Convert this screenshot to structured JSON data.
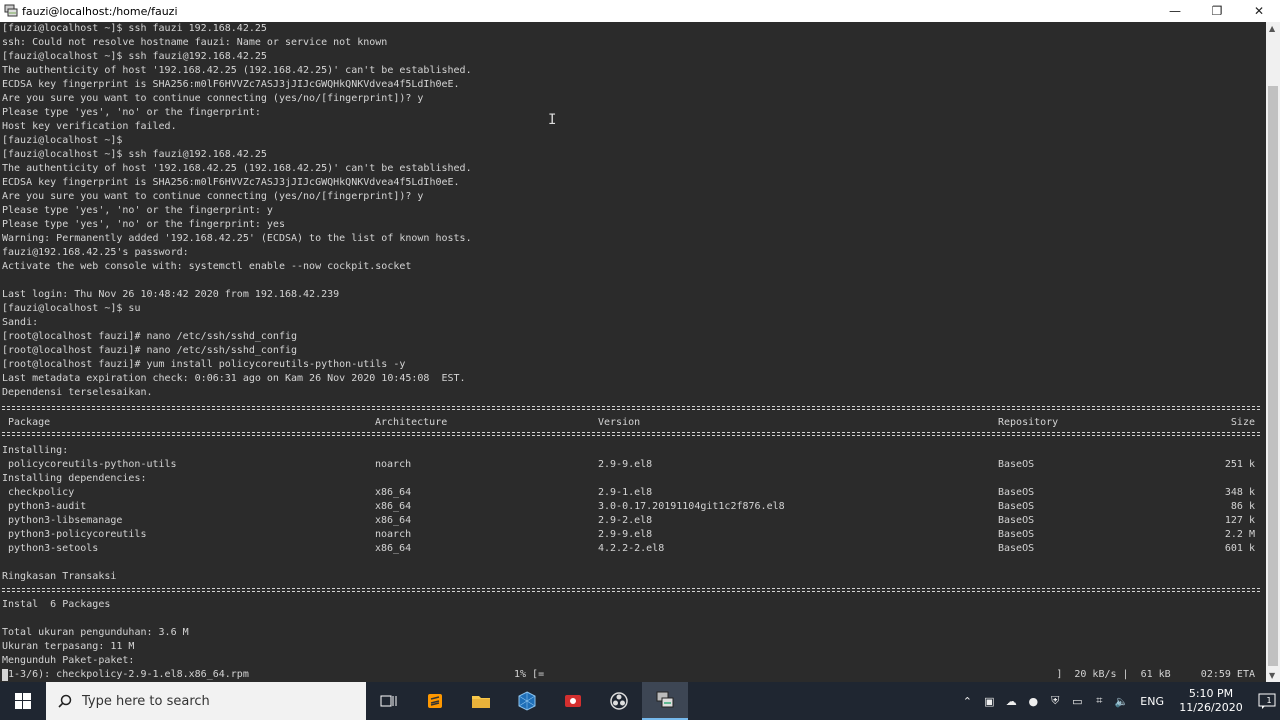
{
  "window": {
    "title": "fauzi@localhost:/home/fauzi",
    "minimize": "—",
    "maximize": "❐",
    "close": "✕"
  },
  "terminal_lines": [
    "[fauzi@localhost ~]$ ssh fauzi 192.168.42.25",
    "ssh: Could not resolve hostname fauzi: Name or service not known",
    "[fauzi@localhost ~]$ ssh fauzi@192.168.42.25",
    "The authenticity of host '192.168.42.25 (192.168.42.25)' can't be established.",
    "ECDSA key fingerprint is SHA256:m0lF6HVVZc7ASJ3jJIJcGWQHkQNKVdvea4f5LdIh0eE.",
    "Are you sure you want to continue connecting (yes/no/[fingerprint])? y",
    "Please type 'yes', 'no' or the fingerprint:",
    "Host key verification failed.",
    "[fauzi@localhost ~]$",
    "[fauzi@localhost ~]$ ssh fauzi@192.168.42.25",
    "The authenticity of host '192.168.42.25 (192.168.42.25)' can't be established.",
    "ECDSA key fingerprint is SHA256:m0lF6HVVZc7ASJ3jJIJcGWQHkQNKVdvea4f5LdIh0eE.",
    "Are you sure you want to continue connecting (yes/no/[fingerprint])? y",
    "Please type 'yes', 'no' or the fingerprint: y",
    "Please type 'yes', 'no' or the fingerprint: yes",
    "Warning: Permanently added '192.168.42.25' (ECDSA) to the list of known hosts.",
    "fauzi@192.168.42.25's password:",
    "Activate the web console with: systemctl enable --now cockpit.socket",
    "",
    "Last login: Thu Nov 26 10:48:42 2020 from 192.168.42.239",
    "[fauzi@localhost ~]$ su",
    "Sandi:",
    "[root@localhost fauzi]# nano /etc/ssh/sshd_config",
    "[root@localhost fauzi]# nano /etc/ssh/sshd_config",
    "[root@localhost fauzi]# yum install policycoreutils-python-utils -y",
    "Last metadata expiration check: 0:06:31 ago on Kam 26 Nov 2020 10:45:08  EST.",
    "Dependensi terselesaikan."
  ],
  "table": {
    "headers": [
      "Package",
      "Architecture",
      "Version",
      "Repository",
      "Size"
    ],
    "installing_label": "Installing:",
    "deps_label": "Installing dependencies:",
    "main_rows": [
      [
        "policycoreutils-python-utils",
        "noarch",
        "2.9-9.el8",
        "BaseOS",
        "251 k"
      ]
    ],
    "dep_rows": [
      [
        "checkpolicy",
        "x86_64",
        "2.9-1.el8",
        "BaseOS",
        "348 k"
      ],
      [
        "python3-audit",
        "x86_64",
        "3.0-0.17.20191104git1c2f876.el8",
        "BaseOS",
        "86 k"
      ],
      [
        "python3-libsemanage",
        "x86_64",
        "2.9-2.el8",
        "BaseOS",
        "127 k"
      ],
      [
        "python3-policycoreutils",
        "noarch",
        "2.9-9.el8",
        "BaseOS",
        "2.2 M"
      ],
      [
        "python3-setools",
        "x86_64",
        "4.2.2-2.el8",
        "BaseOS",
        "601 k"
      ]
    ]
  },
  "summary": {
    "title": "Ringkasan Transaksi",
    "install": "Instal  6 Packages",
    "total_download": "Total ukuran pengunduhan: 3.6 M",
    "installed_size": "Ukuran terpasang: 11 M",
    "downloading": "Mengunduh Paket-paket:",
    "progress_file": "(1-3/6): checkpolicy-2.9-1.el8.x86_64.rpm",
    "progress_pct": "1% [=",
    "progress_right": "]  20 kB/s |  61 kB     02:59 ETA"
  },
  "taskbar": {
    "search_placeholder": "Type here to search",
    "language": "ENG",
    "time": "5:10 PM",
    "date": "11/26/2020",
    "notification_count": "1"
  },
  "colors": {
    "terminal_bg": "#2b2b2b",
    "terminal_fg": "#d4d4d4",
    "taskbar_bg": "#1f2631"
  }
}
